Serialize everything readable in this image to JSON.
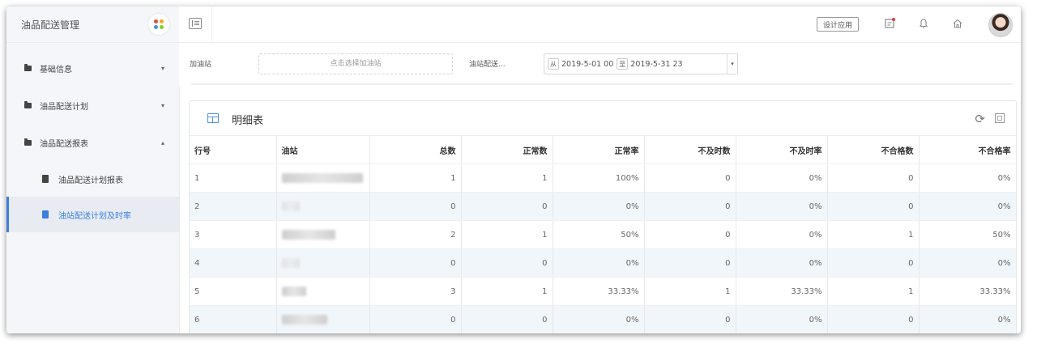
{
  "sidebar": {
    "title": "油品配送管理",
    "items": [
      {
        "label": "基础信息",
        "arrow": "▾"
      },
      {
        "label": "油品配送计划",
        "arrow": "▾"
      },
      {
        "label": "油品配送报表",
        "arrow": "▴"
      }
    ],
    "sub_items": [
      {
        "label": "油品配送计划报表"
      },
      {
        "label": "油站配送计划及时率"
      }
    ]
  },
  "topbar": {
    "design_button": "设计应用"
  },
  "filters": {
    "station_label": "加油站",
    "station_placeholder": "点击选择加油站",
    "date_label": "油站配送...",
    "from_tag": "从",
    "from_value": "2019-5-01 00",
    "to_tag": "至",
    "to_value": "2019-5-31 23",
    "dropdown_arrow": "▾"
  },
  "panel": {
    "title": "明细表",
    "columns": [
      "行号",
      "油站",
      "总数",
      "正常数",
      "正常率",
      "不及时数",
      "不及时率",
      "不合格数",
      "不合格率"
    ],
    "rows": [
      [
        "1",
        "",
        "1",
        "1",
        "100%",
        "0",
        "0%",
        "0",
        "0%"
      ],
      [
        "2",
        "",
        "0",
        "0",
        "0%",
        "0",
        "0%",
        "0",
        "0%"
      ],
      [
        "3",
        "",
        "2",
        "1",
        "50%",
        "0",
        "0%",
        "1",
        "50%"
      ],
      [
        "4",
        "",
        "0",
        "0",
        "0%",
        "0",
        "0%",
        "0",
        "0%"
      ],
      [
        "5",
        "",
        "3",
        "1",
        "33.33%",
        "1",
        "33.33%",
        "1",
        "33.33%"
      ],
      [
        "6",
        "",
        "0",
        "0",
        "0%",
        "0",
        "0%",
        "0",
        "0%"
      ]
    ]
  },
  "colors": {
    "accent": "#3b7fe0",
    "stripe": "#f1f6fb"
  }
}
